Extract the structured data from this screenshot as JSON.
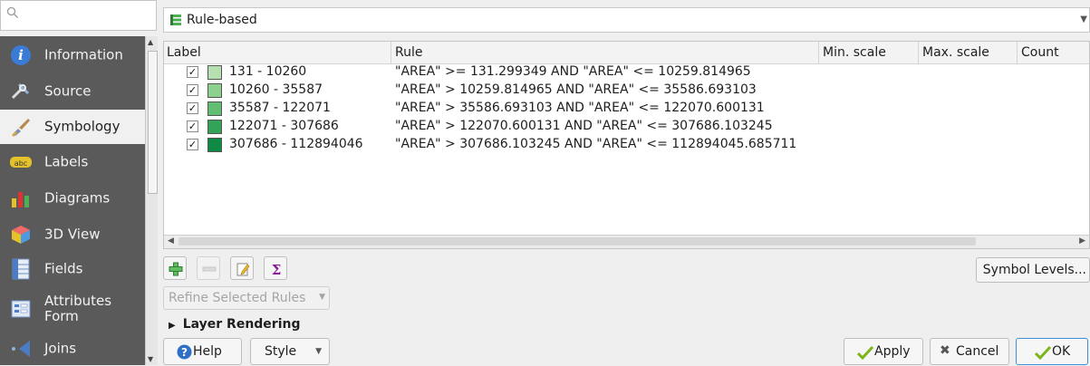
{
  "sidebar": {
    "search_placeholder": "",
    "items": [
      {
        "label": "Information",
        "icon": "info-icon"
      },
      {
        "label": "Source",
        "icon": "source-tools-icon"
      },
      {
        "label": "Symbology",
        "icon": "paintbrush-icon",
        "active": true
      },
      {
        "label": "Labels",
        "icon": "labels-abc-icon"
      },
      {
        "label": "Diagrams",
        "icon": "diagrams-icon"
      },
      {
        "label": "3D View",
        "icon": "cube-3d-icon"
      },
      {
        "label": "Fields",
        "icon": "fields-table-icon"
      },
      {
        "label": "Attributes\nForm",
        "icon": "attributes-form-icon"
      },
      {
        "label": "Joins",
        "icon": "joins-icon"
      }
    ]
  },
  "renderer": {
    "label": "Rule-based",
    "icon": "rule-based-icon"
  },
  "table": {
    "headers": [
      "Label",
      "Rule",
      "Min. scale",
      "Max. scale",
      "Count"
    ],
    "rows": [
      {
        "checked": true,
        "color": "#b6e0b1",
        "label": "131 - 10260",
        "rule": "\"AREA\" >= 131.299349 AND \"AREA\" <= 10259.814965"
      },
      {
        "checked": true,
        "color": "#8ed18f",
        "label": "10260 - 35587",
        "rule": "\"AREA\" > 10259.814965 AND \"AREA\" <= 35586.693103"
      },
      {
        "checked": true,
        "color": "#61bd72",
        "label": "35587 - 122071",
        "rule": "\"AREA\" > 35586.693103 AND \"AREA\" <= 122070.600131"
      },
      {
        "checked": true,
        "color": "#34a35a",
        "label": "122071 - 307686",
        "rule": "\"AREA\" > 122070.600131 AND \"AREA\" <= 307686.103245"
      },
      {
        "checked": true,
        "color": "#0f8a44",
        "label": "307686 - 112894046",
        "rule": "\"AREA\" > 307686.103245 AND \"AREA\" <= 112894045.685711"
      }
    ]
  },
  "toolbar": {
    "add_icon": "add-rule-icon",
    "remove_icon": "remove-rule-icon",
    "edit_icon": "edit-rule-icon",
    "count_icon": "sigma-count-icon",
    "symbol_levels_label": "Symbol Levels...",
    "refine_label": "Refine Selected Rules"
  },
  "layer_rendering": {
    "label": "Layer Rendering"
  },
  "footer": {
    "help_label": "Help",
    "style_label": "Style",
    "apply_label": "Apply",
    "cancel_label": "Cancel",
    "ok_label": "OK"
  }
}
